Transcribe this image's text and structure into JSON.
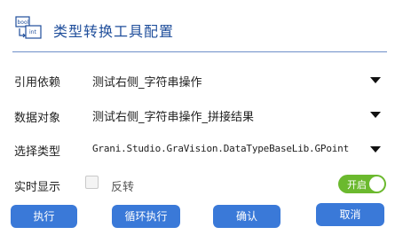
{
  "header": {
    "title": "类型转换工具配置",
    "icon": "bool-int-convert-icon"
  },
  "rows": [
    {
      "label": "引用依赖",
      "value": "测试右侧_字符串操作"
    },
    {
      "label": "数据对象",
      "value": "测试右侧_字符串操作_拼接结果"
    },
    {
      "label": "选择类型",
      "value": "Grani.Studio.GraVision.DataTypeBaseLib.GPoint"
    }
  ],
  "realtime": {
    "label": "实时显示",
    "checkbox_label": "反转",
    "checkbox_checked": false,
    "toggle_label": "开启",
    "toggle_on": true,
    "toggle_color": "#6bb92e"
  },
  "buttons": {
    "execute": "执行",
    "loop_execute": "循环执行",
    "confirm": "确认",
    "cancel": "取消",
    "color": "#3a79d8"
  },
  "app_icon_text": {
    "top": "bool",
    "bottom": "int"
  }
}
